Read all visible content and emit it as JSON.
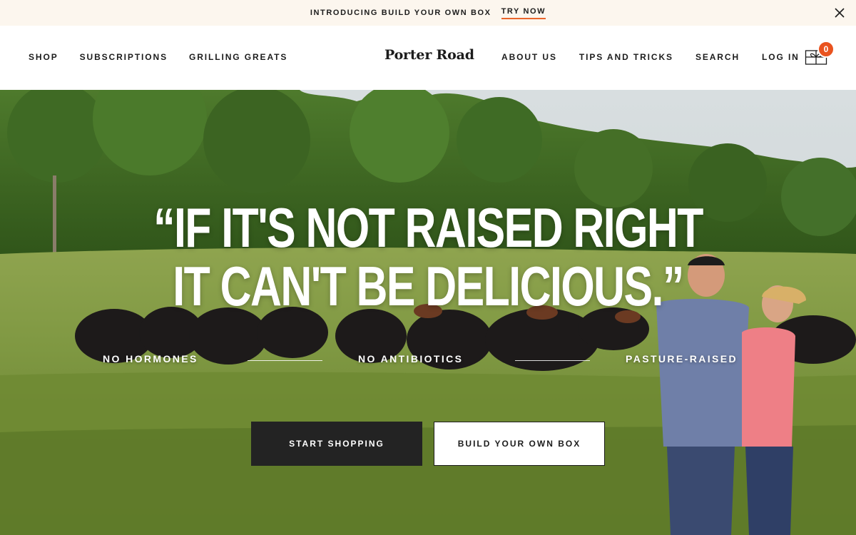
{
  "announcement": {
    "text": "INTRODUCING BUILD YOUR OWN BOX",
    "link": "TRY NOW"
  },
  "header": {
    "logo": "Porter Road",
    "nav_left": [
      "SHOP",
      "SUBSCRIPTIONS",
      "GRILLING GREATS"
    ],
    "nav_right": [
      "ABOUT US",
      "TIPS AND TRICKS",
      "SEARCH",
      "LOG IN"
    ],
    "cart_count": "0"
  },
  "hero": {
    "headline_line1": "“IF IT'S NOT RAISED RIGHT",
    "headline_line2": "IT CAN'T BE DELICIOUS.”",
    "features": [
      "NO HORMONES",
      "NO ANTIBIOTICS",
      "PASTURE-RAISED"
    ],
    "primary_button": "START SHOPPING",
    "secondary_button": "BUILD YOUR OWN BOX"
  },
  "colors": {
    "accent": "#e9531f",
    "announcement_bg": "#fcf6ee",
    "dark_button": "#232323"
  },
  "icons": [
    "close-icon",
    "cart-icon"
  ]
}
